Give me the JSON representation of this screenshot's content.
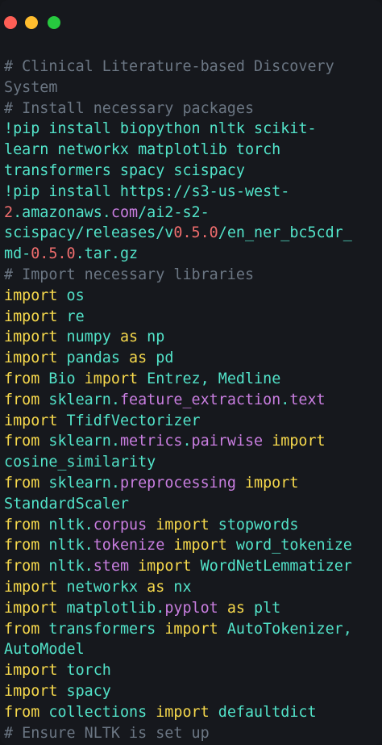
{
  "window": {
    "traffic_lights": [
      {
        "name": "close",
        "color": "#ff5f56"
      },
      {
        "name": "minimize",
        "color": "#ffbd2e"
      },
      {
        "name": "maximize",
        "color": "#27c93f"
      }
    ]
  },
  "colors": {
    "background": "#16181d",
    "keyword": "#f7d94c",
    "module": "#52e3c9",
    "attribute": "#c97ee0",
    "comment": "#6b7683",
    "number": "#ef6d6d",
    "text": "#e6e6e6"
  },
  "code_lines": [
    [
      {
        "t": "# Clinical Literature-based Discovery",
        "c": "comment"
      }
    ],
    [
      {
        "t": "System",
        "c": "comment"
      }
    ],
    [
      {
        "t": "# Install necessary packages",
        "c": "comment"
      }
    ],
    [
      {
        "t": "!pip install biopython nltk scikit-",
        "c": "module"
      }
    ],
    [
      {
        "t": "learn networkx matplotlib torch",
        "c": "module"
      }
    ],
    [
      {
        "t": "transformers spacy scispacy",
        "c": "module"
      }
    ],
    [
      {
        "t": "!pip install https://s3-us-west-",
        "c": "module"
      }
    ],
    [
      {
        "t": "2",
        "c": "number"
      },
      {
        "t": ".amazonaws.",
        "c": "module"
      },
      {
        "t": "com",
        "c": "attr"
      },
      {
        "t": "/ai2-s2-",
        "c": "module"
      }
    ],
    [
      {
        "t": "scispacy/releases/v",
        "c": "module"
      },
      {
        "t": "0.5.0",
        "c": "number"
      },
      {
        "t": "/en_ner_bc5cdr_",
        "c": "module"
      }
    ],
    [
      {
        "t": "md-",
        "c": "module"
      },
      {
        "t": "0.5.0",
        "c": "number"
      },
      {
        "t": ".tar.gz",
        "c": "module"
      }
    ],
    [
      {
        "t": "# Import necessary libraries",
        "c": "comment"
      }
    ],
    [
      {
        "t": "import",
        "c": "keyword"
      },
      {
        "t": " os",
        "c": "module"
      }
    ],
    [
      {
        "t": "import",
        "c": "keyword"
      },
      {
        "t": " re",
        "c": "module"
      }
    ],
    [
      {
        "t": "import",
        "c": "keyword"
      },
      {
        "t": " numpy ",
        "c": "module"
      },
      {
        "t": "as",
        "c": "keyword"
      },
      {
        "t": " np",
        "c": "module"
      }
    ],
    [
      {
        "t": "import",
        "c": "keyword"
      },
      {
        "t": " pandas ",
        "c": "module"
      },
      {
        "t": "as",
        "c": "keyword"
      },
      {
        "t": " pd",
        "c": "module"
      }
    ],
    [
      {
        "t": "from",
        "c": "keyword"
      },
      {
        "t": " Bio ",
        "c": "module"
      },
      {
        "t": "import",
        "c": "keyword"
      },
      {
        "t": " Entrez, Medline",
        "c": "module"
      }
    ],
    [
      {
        "t": "from",
        "c": "keyword"
      },
      {
        "t": " sklearn.",
        "c": "module"
      },
      {
        "t": "feature_extraction",
        "c": "attr"
      },
      {
        "t": ".",
        "c": "module"
      },
      {
        "t": "text",
        "c": "attr"
      }
    ],
    [
      {
        "t": "import",
        "c": "keyword"
      },
      {
        "t": " TfidfVectorizer",
        "c": "module"
      }
    ],
    [
      {
        "t": "from",
        "c": "keyword"
      },
      {
        "t": " sklearn.",
        "c": "module"
      },
      {
        "t": "metrics",
        "c": "attr"
      },
      {
        "t": ".",
        "c": "module"
      },
      {
        "t": "pairwise",
        "c": "attr"
      },
      {
        "t": " import",
        "c": "keyword"
      }
    ],
    [
      {
        "t": "cosine_similarity",
        "c": "module"
      }
    ],
    [
      {
        "t": "from",
        "c": "keyword"
      },
      {
        "t": " sklearn.",
        "c": "module"
      },
      {
        "t": "preprocessing",
        "c": "attr"
      },
      {
        "t": " import",
        "c": "keyword"
      }
    ],
    [
      {
        "t": "StandardScaler",
        "c": "module"
      }
    ],
    [
      {
        "t": "from",
        "c": "keyword"
      },
      {
        "t": " nltk.",
        "c": "module"
      },
      {
        "t": "corpus",
        "c": "attr"
      },
      {
        "t": " import",
        "c": "keyword"
      },
      {
        "t": " stopwords",
        "c": "module"
      }
    ],
    [
      {
        "t": "from",
        "c": "keyword"
      },
      {
        "t": " nltk.",
        "c": "module"
      },
      {
        "t": "tokenize",
        "c": "attr"
      },
      {
        "t": " import",
        "c": "keyword"
      },
      {
        "t": " word_tokenize",
        "c": "module"
      }
    ],
    [
      {
        "t": "from",
        "c": "keyword"
      },
      {
        "t": " nltk.",
        "c": "module"
      },
      {
        "t": "stem",
        "c": "attr"
      },
      {
        "t": " import",
        "c": "keyword"
      },
      {
        "t": " WordNetLemmatizer",
        "c": "module"
      }
    ],
    [
      {
        "t": "import",
        "c": "keyword"
      },
      {
        "t": " networkx ",
        "c": "module"
      },
      {
        "t": "as",
        "c": "keyword"
      },
      {
        "t": " nx",
        "c": "module"
      }
    ],
    [
      {
        "t": "import",
        "c": "keyword"
      },
      {
        "t": " matplotlib.",
        "c": "module"
      },
      {
        "t": "pyplot",
        "c": "attr"
      },
      {
        "t": " as",
        "c": "keyword"
      },
      {
        "t": " plt",
        "c": "module"
      }
    ],
    [
      {
        "t": "from",
        "c": "keyword"
      },
      {
        "t": " transformers ",
        "c": "module"
      },
      {
        "t": "import",
        "c": "keyword"
      },
      {
        "t": " AutoTokenizer,",
        "c": "module"
      }
    ],
    [
      {
        "t": "AutoModel",
        "c": "module"
      }
    ],
    [
      {
        "t": "import",
        "c": "keyword"
      },
      {
        "t": " torch",
        "c": "module"
      }
    ],
    [
      {
        "t": "import",
        "c": "keyword"
      },
      {
        "t": " spacy",
        "c": "module"
      }
    ],
    [
      {
        "t": "from",
        "c": "keyword"
      },
      {
        "t": " collections ",
        "c": "module"
      },
      {
        "t": "import",
        "c": "keyword"
      },
      {
        "t": " defaultdict",
        "c": "module"
      }
    ],
    [
      {
        "t": "# Ensure NLTK is set up",
        "c": "comment"
      }
    ]
  ]
}
